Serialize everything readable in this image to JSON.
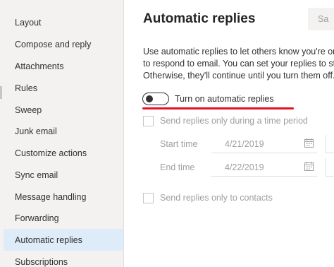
{
  "sidebar": {
    "items": [
      {
        "label": "Layout"
      },
      {
        "label": "Compose and reply"
      },
      {
        "label": "Attachments"
      },
      {
        "label": "Rules"
      },
      {
        "label": "Sweep"
      },
      {
        "label": "Junk email"
      },
      {
        "label": "Customize actions"
      },
      {
        "label": "Sync email"
      },
      {
        "label": "Message handling"
      },
      {
        "label": "Forwarding"
      },
      {
        "label": "Automatic replies",
        "active": true
      },
      {
        "label": "Subscriptions"
      }
    ]
  },
  "main": {
    "title": "Automatic replies",
    "save_label": "Sa",
    "description": [
      "Use automatic replies to let others know you're on",
      "to respond to email. You can set your replies to star",
      "Otherwise, they'll continue until you turn them off."
    ],
    "toggle": {
      "label": "Turn on automatic replies",
      "on": false
    },
    "time_period_checkbox": {
      "label": "Send replies only during a time period",
      "checked": false
    },
    "start": {
      "label": "Start time",
      "date": "4/21/2019"
    },
    "end": {
      "label": "End time",
      "date": "4/22/2019"
    },
    "contacts_checkbox": {
      "label": "Send replies only to contacts",
      "checked": false
    }
  },
  "colors": {
    "sidebar_bg": "#f3f2f1",
    "active_item_bg": "#deecf9",
    "annotation_underline": "#e81123",
    "disabled_text": "#a19f9d"
  },
  "icons": {
    "date_picker": "calendar-icon"
  }
}
